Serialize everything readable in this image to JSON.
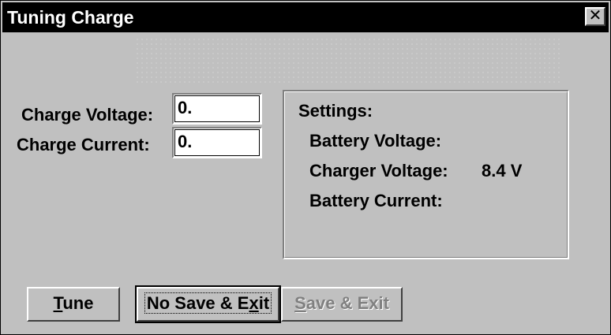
{
  "window": {
    "title": "Tuning Charge",
    "close_glyph": "✕"
  },
  "form": {
    "charge_voltage_label": "Charge Voltage:",
    "charge_voltage_value": "0.",
    "charge_current_label": "Charge Current:",
    "charge_current_value": "0."
  },
  "settings": {
    "title": "Settings:",
    "battery_voltage_label": "Battery Voltage:",
    "battery_voltage_value": "",
    "charger_voltage_label": "Charger Voltage:",
    "charger_voltage_value": "8.4 V",
    "battery_current_label": "Battery Current:",
    "battery_current_value": ""
  },
  "buttons": {
    "tune": {
      "prefix": "",
      "accel": "T",
      "suffix": "une",
      "enabled": true
    },
    "no_save_exit": {
      "prefix": "No Save & E",
      "accel": "x",
      "suffix": "it",
      "enabled": true,
      "default": true
    },
    "save_exit": {
      "prefix": "",
      "accel": "S",
      "suffix": "ave & Exit",
      "enabled": false
    }
  },
  "colors": {
    "face": "#c0c0c0",
    "titlebar": "#000000",
    "disabled_text": "#808080"
  }
}
